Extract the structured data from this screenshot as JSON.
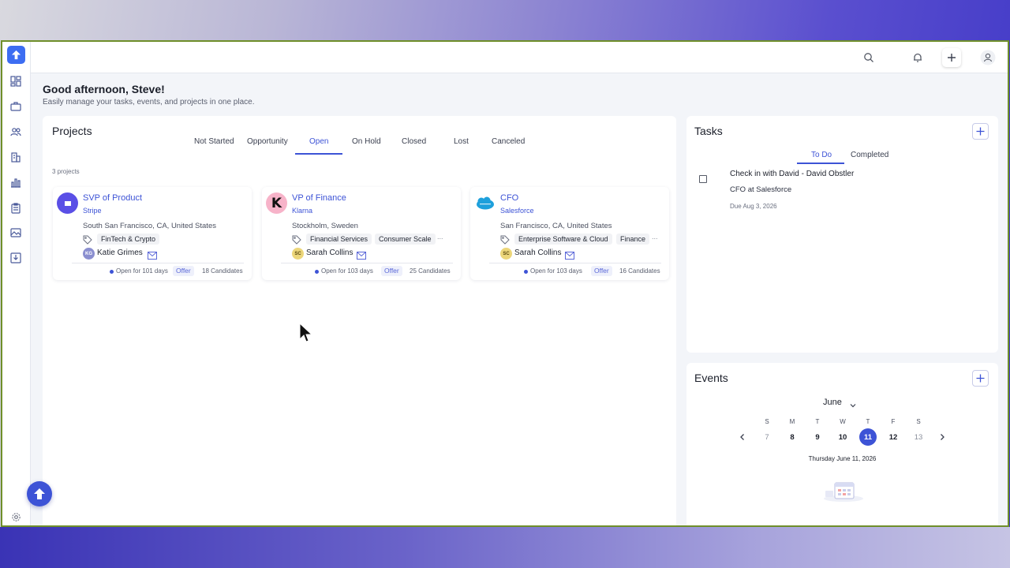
{
  "greeting": {
    "title": "Good afternoon, Steve!",
    "subtitle": "Easily manage your tasks, events, and projects in one place."
  },
  "sidebar": {
    "items": [
      {
        "icon": "dashboard-icon"
      },
      {
        "icon": "briefcase-icon"
      },
      {
        "icon": "people-icon"
      },
      {
        "icon": "building-icon"
      },
      {
        "icon": "bar-chart-icon"
      },
      {
        "icon": "clipboard-icon"
      },
      {
        "icon": "image-icon"
      },
      {
        "icon": "download-icon"
      }
    ],
    "settings_icon": "gear-icon"
  },
  "topbar": {
    "icons": [
      "search-icon",
      "bell-icon",
      "plus-icon",
      "user-icon"
    ]
  },
  "projects": {
    "title": "Projects",
    "tabs": [
      "Not Started",
      "Opportunity",
      "Open",
      "On Hold",
      "Closed",
      "Lost",
      "Canceled"
    ],
    "active_tab": "Open",
    "count": "3 projects",
    "cards": [
      {
        "title": "SVP of Product",
        "company": "Stripe",
        "location": "South San Francisco, CA, United States",
        "tags": [
          "FinTech & Crypto"
        ],
        "person": "Katie Grimes",
        "initials": "KG",
        "open_for": "Open for 101 days",
        "stage": "Offer",
        "candidates": "18 Candidates"
      },
      {
        "title": "VP of Finance",
        "company": "Klarna",
        "location": "Stockholm, Sweden",
        "tags": [
          "Financial Services",
          "Consumer Scale"
        ],
        "more": "...",
        "person": "Sarah Collins",
        "initials": "SC",
        "open_for": "Open for 103 days",
        "stage": "Offer",
        "candidates": "25 Candidates"
      },
      {
        "title": "CFO",
        "company": "Salesforce",
        "location": "San Francisco, CA, United States",
        "tags": [
          "Enterprise Software & Cloud",
          "Finance"
        ],
        "more": "...",
        "person": "Sarah Collins",
        "initials": "SC",
        "open_for": "Open for 103 days",
        "stage": "Offer",
        "candidates": "16 Candidates"
      }
    ]
  },
  "tasks": {
    "title": "Tasks",
    "tabs": [
      "To Do",
      "Completed"
    ],
    "active_tab": "To Do",
    "items": [
      {
        "title": "Check in with David - David Obstler",
        "subtitle": "CFO at Salesforce",
        "due": "Due Aug 3, 2026"
      }
    ]
  },
  "events": {
    "title": "Events",
    "month": "June",
    "weekdays": [
      "S",
      "M",
      "T",
      "W",
      "T",
      "F",
      "S"
    ],
    "days": [
      "7",
      "8",
      "9",
      "10",
      "11",
      "12",
      "13"
    ],
    "selected_day": "11",
    "selected_label": "Thursday June 11, 2026"
  },
  "colors": {
    "accent": "#3d53d6",
    "logo": "#3d6df2",
    "frame_border": "#6f8f2a"
  }
}
